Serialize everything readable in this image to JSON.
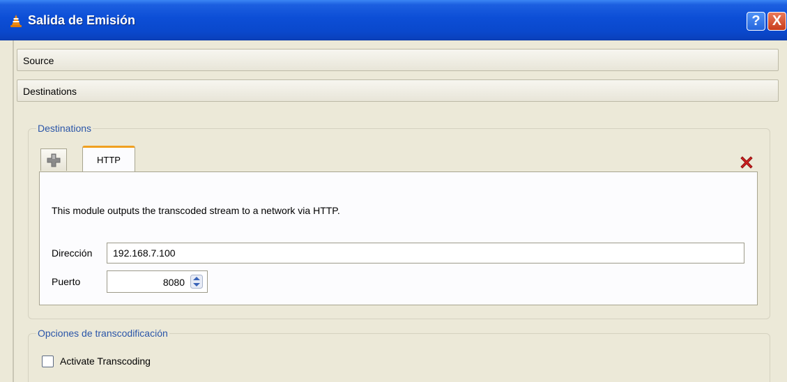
{
  "window": {
    "title": "Salida de Emisión",
    "icon": "vlc-cone-icon",
    "help_label": "?",
    "close_label": "X"
  },
  "sections": {
    "source_label": "Source",
    "destinations_label": "Destinations"
  },
  "destinations_group": {
    "title": "Destinations",
    "tabs": [
      {
        "label": "",
        "icon": "add-plus-icon"
      },
      {
        "label": "HTTP",
        "active": true
      }
    ],
    "remove_icon": "red-x-icon",
    "description": "This module outputs the transcoded stream to a network via HTTP.",
    "address_label": "Dirección",
    "address_value": "192.168.7.100",
    "port_label": "Puerto",
    "port_value": "8080"
  },
  "transcode_group": {
    "title": "Opciones de transcodificación",
    "checkbox_label": "Activate Transcoding",
    "checked": false
  },
  "colors": {
    "titlebar": "#0a48cc",
    "group_title": "#2a55a8",
    "active_tab_accent": "#f0a020",
    "remove_red": "#d02020"
  }
}
